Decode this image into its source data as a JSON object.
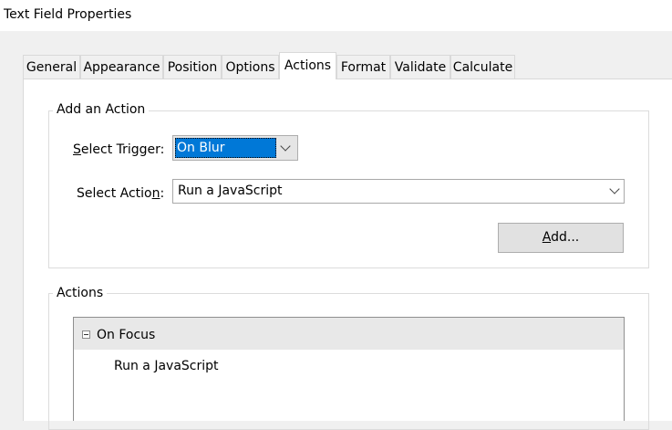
{
  "window": {
    "title": "Text Field Properties"
  },
  "tabs": [
    {
      "label": "General"
    },
    {
      "label": "Appearance"
    },
    {
      "label": "Position"
    },
    {
      "label": "Options"
    },
    {
      "label": "Actions",
      "active": true
    },
    {
      "label": "Format"
    },
    {
      "label": "Validate"
    },
    {
      "label": "Calculate"
    }
  ],
  "add_action": {
    "group_label": "Add an Action",
    "trigger_label_prefix": "S",
    "trigger_label_rest": "elect Trigger:",
    "trigger_value": "On Blur",
    "action_label_prefix": "Select Actio",
    "action_label_underlined": "n",
    "action_label_suffix": ":",
    "action_value": "Run a JavaScript",
    "add_button_underlined": "A",
    "add_button_rest": "dd..."
  },
  "actions": {
    "group_label": "Actions",
    "tree": [
      {
        "trigger": "On Focus",
        "expanded": true,
        "children": [
          "Run a JavaScript"
        ]
      }
    ]
  }
}
